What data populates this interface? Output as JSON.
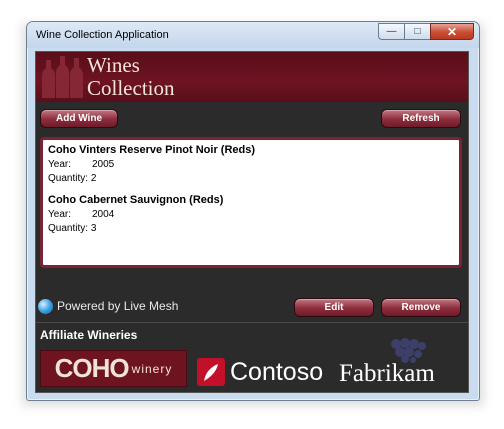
{
  "window": {
    "title": "Wine Collection Application",
    "minimize_glyph": "—",
    "maximize_glyph": "□",
    "close_glyph": "✕"
  },
  "banner": {
    "title_line1": "Wines",
    "title_line2": "Collection"
  },
  "toolbar": {
    "add_wine_label": "Add Wine",
    "refresh_label": "Refresh"
  },
  "wines": [
    {
      "name": "Coho Vinters Reserve Pinot Noir (Reds)",
      "year_label": "Year:",
      "year": "2005",
      "quantity_label": "Quantity:",
      "quantity": "2"
    },
    {
      "name": "Coho Cabernet Sauvignon (Reds)",
      "year_label": "Year:",
      "year": "2004",
      "quantity_label": "Quantity:",
      "quantity": "3"
    }
  ],
  "footer": {
    "powered_by": "Powered by Live Mesh",
    "edit_label": "Edit",
    "remove_label": "Remove"
  },
  "affiliates": {
    "heading": "Affiliate Wineries",
    "coho_main": "COHO",
    "coho_sub": "winery",
    "contoso": "Contoso",
    "fabrikam": "Fabrikam"
  },
  "colors": {
    "brand_wine": "#6e1322",
    "button_wine": "#8c2c3b",
    "panel_bg": "#2b2b2b"
  },
  "icons": {
    "banner": "wine-bottles-icon",
    "mesh": "live-mesh-icon",
    "contoso": "contoso-logo-icon",
    "fabrikam": "grapes-icon"
  }
}
